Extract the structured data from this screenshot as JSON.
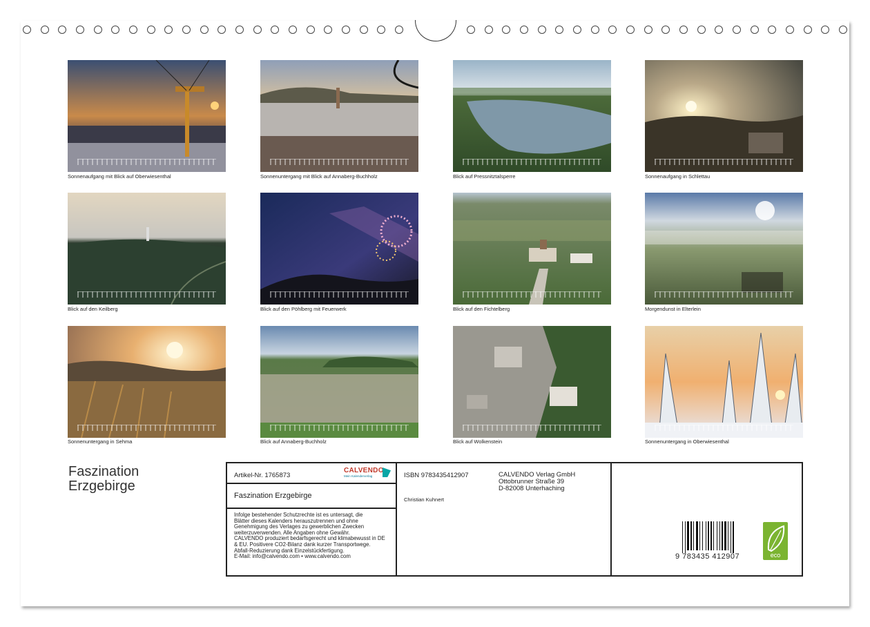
{
  "photos": [
    {
      "caption": "Sonnenaufgang mit Blick auf Oberwiesenthal"
    },
    {
      "caption": "Sonnenuntergang mit Blick auf Annaberg-Buchholz"
    },
    {
      "caption": "Blick auf Pressnitztalsperre"
    },
    {
      "caption": "Sonnenaufgang in Schlettau"
    },
    {
      "caption": "Blick auf den Keilberg"
    },
    {
      "caption": "Blick auf den Pöhlberg mit Feuerwerk"
    },
    {
      "caption": "Blick auf den Fichtelberg"
    },
    {
      "caption": "Morgendunst in Elterlein"
    },
    {
      "caption": "Sonnenuntergang in Sehma"
    },
    {
      "caption": "Blick auf Annaberg-Buchholz"
    },
    {
      "caption": "Blick auf Wolkenstein"
    },
    {
      "caption": "Sonnenuntergang in Oberwiesenthal"
    }
  ],
  "title": {
    "line1": "Faszination",
    "line2": "Erzgebirge"
  },
  "info": {
    "article": "Artikel-Nr. 1765873",
    "logo": "CALVENDO",
    "logo_sub": "Mein Kalenderverlag",
    "product_title": "Faszination Erzgebirge",
    "legal": [
      "Infolge bestehender Schutzrechte ist es untersagt, die",
      "Blätter dieses Kalenders herauszutrennen und ohne",
      "Genehmigung des Verlages zu gewerblichen Zwecken",
      "weiterzuverwenden. Alle Angaben ohne Gewähr.",
      "CALVENDO produziert bedarfsgerecht und klimabewusst in DE",
      "& EU. Positivere CO2-Bilanz dank kurzer Transportwege.",
      "Abfall-Reduzierung dank Einzelstückfertigung.",
      "E-Mail: info@calvendo.com • www.calvendo.com"
    ],
    "isbn": "ISBN 9783435412907",
    "author": "Christian Kuhnert",
    "publisher": [
      "CALVENDO Verlag GmbH",
      "Ottobrunner Straße 39",
      "D-82008 Unterhaching"
    ],
    "barcode_number": "9 783435 412907",
    "eco_label": "eco"
  }
}
